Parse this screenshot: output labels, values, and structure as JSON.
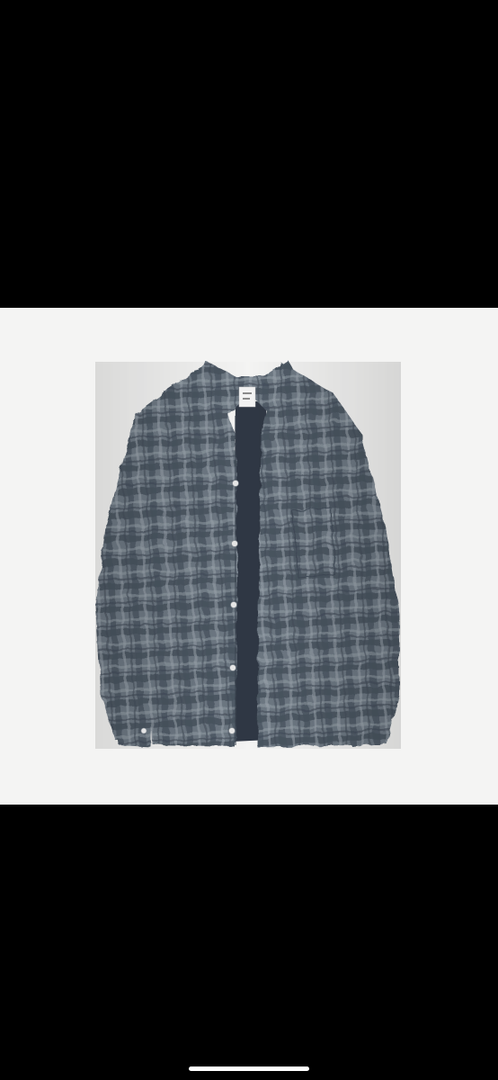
{
  "viewer": {
    "background": "#000000",
    "photo_background": "#f4f4f3",
    "image_description_icon": "plaid-shirt-image"
  },
  "garment": {
    "colors": {
      "base": "#6d7883",
      "dark": "#3f4a57",
      "light": "#9aa3ac",
      "inner": "#2f3744",
      "button": "#e6e6e6"
    },
    "label_text": ""
  },
  "carousel": {
    "progress": 0.5,
    "track_color": "#c9c9c9",
    "fill_color": "#222222"
  },
  "system": {
    "home_indicator_color": "#ffffff"
  }
}
